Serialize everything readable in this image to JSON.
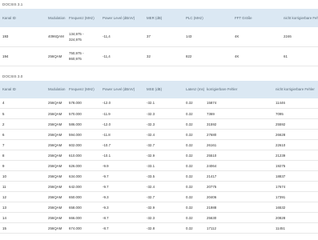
{
  "docsis31": {
    "title": "DOCSIS 3.1",
    "headers": [
      "Kanal ID",
      "Modulation",
      "Frequenz (MHz)",
      "Power Level (dBmV)",
      "MER (dB)",
      "PLC (MHz)",
      "FFT Größe",
      "nicht korrigierbare Fehler"
    ],
    "rows": [
      {
        "kanal": "193",
        "modulation": "4096QAM",
        "freq": [
          "134,975 -",
          "324,975"
        ],
        "power": "-11,4",
        "mer": "37",
        "plc": "143",
        "fft": "4K",
        "fehler": "2246"
      },
      {
        "kanal": "194",
        "modulation": "256QAM",
        "freq": [
          "750,975 -",
          "860,975"
        ],
        "power": "-11,4",
        "mer": "32",
        "plc": "822",
        "fft": "4K",
        "fehler": "61"
      }
    ]
  },
  "docsis30": {
    "title": "DOCSIS 3.0",
    "headers": [
      "Kanal ID",
      "Modulation",
      "Frequenz (MHz)",
      "Power Level (dBmV)",
      "MSE (dB)",
      "Latenz (ms)",
      "korrigierbare Fehler",
      "nicht korrigierbare Fehler"
    ],
    "rows": [
      {
        "kanal": "4",
        "modulation": "256QAM",
        "freq": "578.000",
        "power": "-12.0",
        "mse": "-32.1",
        "latenz": "0.32",
        "korr": "15874",
        "fehler": "11446"
      },
      {
        "kanal": "5",
        "modulation": "256QAM",
        "freq": "570.000",
        "power": "-11.9",
        "mse": "-32.3",
        "latenz": "0.32",
        "korr": "7369",
        "fehler": "7095"
      },
      {
        "kanal": "2",
        "modulation": "256QAM",
        "freq": "586.000",
        "power": "-12.0",
        "mse": "-32.3",
        "latenz": "0.32",
        "korr": "31592",
        "fehler": "25592"
      },
      {
        "kanal": "6",
        "modulation": "256QAM",
        "freq": "594.000",
        "power": "-11.8",
        "mse": "-32.4",
        "latenz": "0.32",
        "korr": "27680",
        "fehler": "26628"
      },
      {
        "kanal": "7",
        "modulation": "256QAM",
        "freq": "602.000",
        "power": "-10.7",
        "mse": "-32.7",
        "latenz": "0.32",
        "korr": "26161",
        "fehler": "22610"
      },
      {
        "kanal": "8",
        "modulation": "256QAM",
        "freq": "610.000",
        "power": "-10.1",
        "mse": "-32.9",
        "latenz": "0.32",
        "korr": "25510",
        "fehler": "21239"
      },
      {
        "kanal": "9",
        "modulation": "256QAM",
        "freq": "626.000",
        "power": "-9.9",
        "mse": "-33.1",
        "latenz": "0.32",
        "korr": "24064",
        "fehler": "19275"
      },
      {
        "kanal": "10",
        "modulation": "256QAM",
        "freq": "634.000",
        "power": "-9.7",
        "mse": "-33.5",
        "latenz": "0.32",
        "korr": "21417",
        "fehler": "18837"
      },
      {
        "kanal": "11",
        "modulation": "256QAM",
        "freq": "642.000",
        "power": "-9.7",
        "mse": "-32.4",
        "latenz": "0.32",
        "korr": "20775",
        "fehler": "17674"
      },
      {
        "kanal": "12",
        "modulation": "256QAM",
        "freq": "650.000",
        "power": "-9.3",
        "mse": "-32.7",
        "latenz": "0.32",
        "korr": "20406",
        "fehler": "17391"
      },
      {
        "kanal": "13",
        "modulation": "256QAM",
        "freq": "658.000",
        "power": "-9.3",
        "mse": "-32.9",
        "latenz": "0.32",
        "korr": "21988",
        "fehler": "16532"
      },
      {
        "kanal": "14",
        "modulation": "256QAM",
        "freq": "666.000",
        "power": "-8.7",
        "mse": "-32.3",
        "latenz": "0.32",
        "korr": "25630",
        "fehler": "20828"
      },
      {
        "kanal": "15",
        "modulation": "256QAM",
        "freq": "674.000",
        "power": "-8.7",
        "mse": "-32.8",
        "latenz": "0.32",
        "korr": "17112",
        "fehler": "11451"
      }
    ]
  }
}
